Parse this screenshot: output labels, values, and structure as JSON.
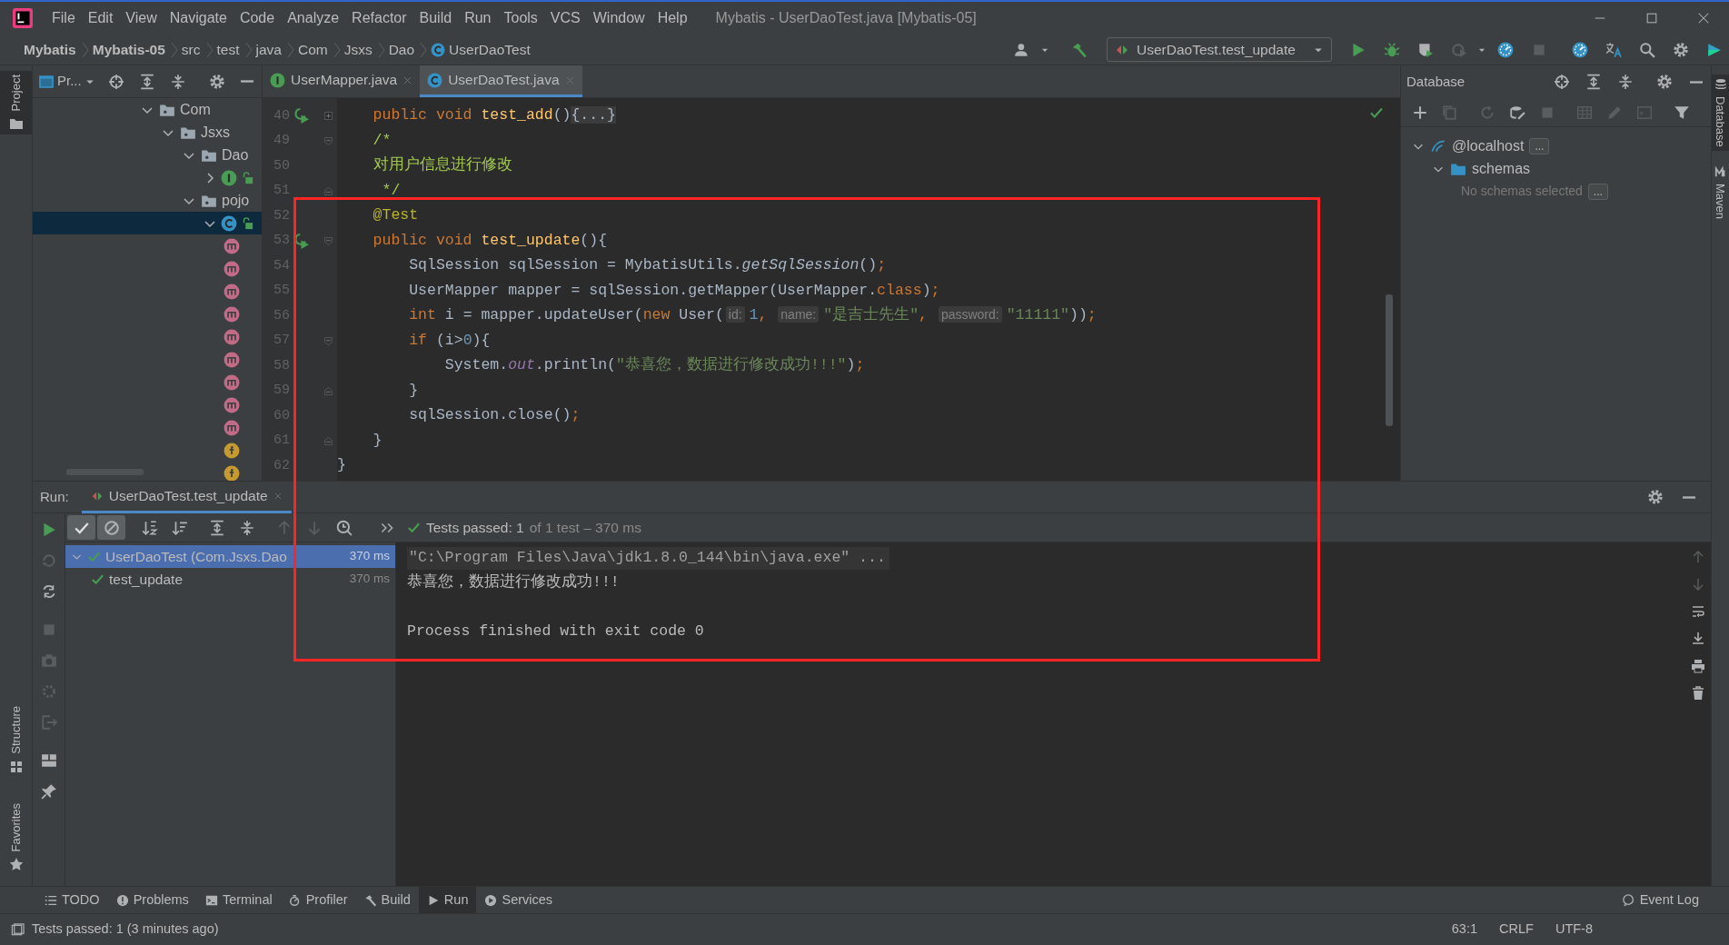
{
  "window": {
    "title": "Mybatis - UserDaoTest.java [Mybatis-05]"
  },
  "menu": [
    "File",
    "Edit",
    "View",
    "Navigate",
    "Code",
    "Analyze",
    "Refactor",
    "Build",
    "Run",
    "Tools",
    "VCS",
    "Window",
    "Help"
  ],
  "breadcrumbs": [
    {
      "label": "Mybatis",
      "kind": "project"
    },
    {
      "label": "Mybatis-05",
      "kind": "module"
    },
    {
      "label": "src",
      "kind": "folder"
    },
    {
      "label": "test",
      "kind": "folder"
    },
    {
      "label": "java",
      "kind": "folder"
    },
    {
      "label": "Com",
      "kind": "folder"
    },
    {
      "label": "Jsxs",
      "kind": "folder"
    },
    {
      "label": "Dao",
      "kind": "folder"
    },
    {
      "label": "UserDaoTest",
      "kind": "class"
    }
  ],
  "run_config": {
    "label": "UserDaoTest.test_update"
  },
  "left_stripe": [
    {
      "label": "Project",
      "kind": "project",
      "selected": true
    },
    {
      "label": "Structure",
      "kind": "structure",
      "selected": false
    },
    {
      "label": "Favorites",
      "kind": "favorites",
      "selected": false
    }
  ],
  "right_stripe": [
    {
      "label": "Database",
      "kind": "database",
      "selected": true
    },
    {
      "label": "Maven",
      "kind": "maven",
      "selected": false
    }
  ],
  "project_panel": {
    "title": "Pr...",
    "tree": [
      {
        "label": "Com",
        "kind": "package",
        "expanded": true,
        "selected": false,
        "children": [
          {
            "label": "Jsxs",
            "kind": "package",
            "expanded": true,
            "selected": false,
            "children": [
              {
                "label": "Dao",
                "kind": "package",
                "expanded": true,
                "selected": false,
                "children": [
                  {
                    "kind": "interface",
                    "expanded": false,
                    "selected": false
                  }
                ]
              },
              {
                "label": "pojo",
                "kind": "package",
                "expanded": true,
                "selected": false,
                "children": [
                  {
                    "kind": "class",
                    "expanded": true,
                    "selected": true,
                    "children": [
                      {
                        "kind": "method",
                        "selected": false
                      },
                      {
                        "kind": "method",
                        "selected": false
                      },
                      {
                        "kind": "method",
                        "selected": false
                      },
                      {
                        "kind": "method",
                        "selected": false
                      },
                      {
                        "kind": "method",
                        "selected": false
                      },
                      {
                        "kind": "method",
                        "selected": false
                      },
                      {
                        "kind": "method",
                        "selected": false
                      },
                      {
                        "kind": "method",
                        "selected": false
                      },
                      {
                        "kind": "method",
                        "selected": false
                      },
                      {
                        "kind": "field",
                        "selected": false
                      },
                      {
                        "kind": "field",
                        "selected": false
                      }
                    ]
                  }
                ]
              }
            ]
          }
        ]
      }
    ]
  },
  "editor": {
    "tabs": [
      {
        "label": "UserMapper.java",
        "kind": "interface",
        "selected": false
      },
      {
        "label": "UserDaoTest.java",
        "kind": "class",
        "selected": true
      }
    ],
    "lines": [
      {
        "number": "40",
        "runnable": true,
        "fold_collapsed": true,
        "tokens": [
          {
            "text": "    public void ",
            "kind": "keyword"
          },
          {
            "text": "test_add",
            "kind": "method"
          },
          {
            "text": "()",
            "kind": "plain"
          },
          {
            "text": "{...}",
            "kind": "folded"
          }
        ]
      },
      {
        "number": "49",
        "fold_start": true,
        "tokens": [
          {
            "text": "    /*",
            "kind": "comment"
          }
        ]
      },
      {
        "number": "50",
        "tokens": [
          {
            "text": "    对用户信息进行修改",
            "kind": "comment"
          }
        ]
      },
      {
        "number": "51",
        "fold_end": true,
        "tokens": [
          {
            "text": "     */",
            "kind": "comment"
          }
        ]
      },
      {
        "number": "52",
        "tokens": [
          {
            "text": "    @Test",
            "kind": "annotation"
          }
        ]
      },
      {
        "number": "53",
        "runnable": true,
        "fold_start": true,
        "tokens": [
          {
            "text": "    public void ",
            "kind": "keyword"
          },
          {
            "text": "test_update",
            "kind": "method"
          },
          {
            "text": "(){",
            "kind": "plain"
          }
        ]
      },
      {
        "number": "54",
        "tokens": [
          {
            "text": "        SqlSession sqlSession = MybatisUtils.",
            "kind": "plain"
          },
          {
            "text": "getSqlSession",
            "kind": "static"
          },
          {
            "text": "()",
            "kind": "plain"
          },
          {
            "text": ";",
            "kind": "keyword"
          }
        ]
      },
      {
        "number": "55",
        "tokens": [
          {
            "text": "        UserMapper mapper = sqlSession.getMapper(UserMapper.",
            "kind": "plain"
          },
          {
            "text": "class",
            "kind": "keyword"
          },
          {
            "text": ")",
            "kind": "plain"
          },
          {
            "text": ";",
            "kind": "keyword"
          }
        ]
      },
      {
        "number": "56",
        "tokens": [
          {
            "text": "        int",
            "kind": "keyword"
          },
          {
            "text": " i = mapper.updateUser(",
            "kind": "plain"
          },
          {
            "text": "new",
            "kind": "keyword"
          },
          {
            "text": " User(",
            "kind": "plain"
          },
          {
            "text": "id:",
            "kind": "hint"
          },
          {
            "text": "1",
            "kind": "number"
          },
          {
            "text": ", ",
            "kind": "keyword"
          },
          {
            "text": "name:",
            "kind": "hint"
          },
          {
            "text": "\"是吉士先生\"",
            "kind": "string"
          },
          {
            "text": ", ",
            "kind": "keyword"
          },
          {
            "text": "password:",
            "kind": "hint"
          },
          {
            "text": "\"11111\"",
            "kind": "string"
          },
          {
            "text": "))",
            "kind": "plain"
          },
          {
            "text": ";",
            "kind": "keyword"
          }
        ]
      },
      {
        "number": "57",
        "fold_start": true,
        "tokens": [
          {
            "text": "        if",
            "kind": "keyword"
          },
          {
            "text": " (i>",
            "kind": "plain"
          },
          {
            "text": "0",
            "kind": "number"
          },
          {
            "text": "){",
            "kind": "plain"
          }
        ]
      },
      {
        "number": "58",
        "tokens": [
          {
            "text": "            System.",
            "kind": "plain"
          },
          {
            "text": "out",
            "kind": "field"
          },
          {
            "text": ".println(",
            "kind": "plain"
          },
          {
            "text": "\"恭喜您，数据进行修改成功!!!\"",
            "kind": "string"
          },
          {
            "text": ")",
            "kind": "plain"
          },
          {
            "text": ";",
            "kind": "keyword"
          }
        ]
      },
      {
        "number": "59",
        "fold_end": true,
        "tokens": [
          {
            "text": "        }",
            "kind": "plain"
          }
        ]
      },
      {
        "number": "60",
        "tokens": [
          {
            "text": "        sqlSession.close()",
            "kind": "plain"
          },
          {
            "text": ";",
            "kind": "keyword"
          }
        ]
      },
      {
        "number": "61",
        "fold_end": true,
        "tokens": [
          {
            "text": "    }",
            "kind": "plain"
          }
        ]
      },
      {
        "number": "62",
        "tokens": [
          {
            "text": "}",
            "kind": "plain"
          }
        ]
      }
    ]
  },
  "database": {
    "title": "Database",
    "tree": [
      {
        "label": "@localhost",
        "kind": "host",
        "button": "...",
        "expanded": true,
        "children": [
          {
            "label": "schemas",
            "kind": "folder",
            "expanded": true
          }
        ]
      }
    ],
    "note": "No schemas selected",
    "note_button": "..."
  },
  "run": {
    "label": "Run:",
    "tab": "UserDaoTest.test_update",
    "filters": [
      {
        "kind": "passed",
        "on": true
      },
      {
        "kind": "ignored",
        "on": true
      }
    ],
    "status": "Tests passed: 1",
    "status_detail": "of 1 test – 370 ms",
    "tests": [
      {
        "label": "UserDaoTest (Com.Jsxs.Dao",
        "time": "370 ms",
        "passed": true,
        "selected": true,
        "expanded": true,
        "children": [
          {
            "label": "test_update",
            "time": "370 ms",
            "passed": true,
            "selected": false
          }
        ]
      }
    ],
    "console": [
      {
        "text": "\"C:\\Program Files\\Java\\jdk1.8.0_144\\bin\\java.exe\" ...",
        "kind": "command"
      },
      {
        "text": "恭喜您，数据进行修改成功!!!",
        "kind": "output"
      },
      {
        "text": "Process finished with exit code 0",
        "kind": "exit"
      }
    ]
  },
  "tool_windows": [
    {
      "label": "TODO",
      "kind": "todo",
      "selected": false
    },
    {
      "label": "Problems",
      "kind": "problems",
      "selected": false
    },
    {
      "label": "Terminal",
      "kind": "terminal",
      "selected": false
    },
    {
      "label": "Profiler",
      "kind": "profiler",
      "selected": false
    },
    {
      "label": "Build",
      "kind": "build",
      "selected": false
    },
    {
      "label": "Run",
      "kind": "run",
      "selected": true
    },
    {
      "label": "Services",
      "kind": "services",
      "selected": false
    }
  ],
  "event_log": "Event Log",
  "status_bar": {
    "message": "Tests passed: 1 (3 minutes ago)",
    "position": "63:1",
    "line_separator": "CRLF",
    "encoding": "UTF-8"
  }
}
